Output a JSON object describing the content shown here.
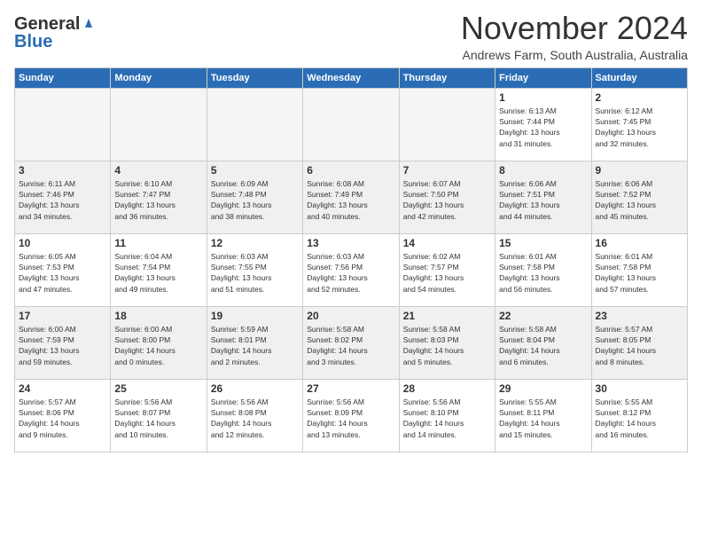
{
  "header": {
    "logo_line1": "General",
    "logo_line2": "Blue",
    "month": "November 2024",
    "location": "Andrews Farm, South Australia, Australia"
  },
  "weekdays": [
    "Sunday",
    "Monday",
    "Tuesday",
    "Wednesday",
    "Thursday",
    "Friday",
    "Saturday"
  ],
  "weeks": [
    [
      {
        "day": "",
        "info": ""
      },
      {
        "day": "",
        "info": ""
      },
      {
        "day": "",
        "info": ""
      },
      {
        "day": "",
        "info": ""
      },
      {
        "day": "",
        "info": ""
      },
      {
        "day": "1",
        "info": "Sunrise: 6:13 AM\nSunset: 7:44 PM\nDaylight: 13 hours\nand 31 minutes."
      },
      {
        "day": "2",
        "info": "Sunrise: 6:12 AM\nSunset: 7:45 PM\nDaylight: 13 hours\nand 32 minutes."
      }
    ],
    [
      {
        "day": "3",
        "info": "Sunrise: 6:11 AM\nSunset: 7:46 PM\nDaylight: 13 hours\nand 34 minutes."
      },
      {
        "day": "4",
        "info": "Sunrise: 6:10 AM\nSunset: 7:47 PM\nDaylight: 13 hours\nand 36 minutes."
      },
      {
        "day": "5",
        "info": "Sunrise: 6:09 AM\nSunset: 7:48 PM\nDaylight: 13 hours\nand 38 minutes."
      },
      {
        "day": "6",
        "info": "Sunrise: 6:08 AM\nSunset: 7:49 PM\nDaylight: 13 hours\nand 40 minutes."
      },
      {
        "day": "7",
        "info": "Sunrise: 6:07 AM\nSunset: 7:50 PM\nDaylight: 13 hours\nand 42 minutes."
      },
      {
        "day": "8",
        "info": "Sunrise: 6:06 AM\nSunset: 7:51 PM\nDaylight: 13 hours\nand 44 minutes."
      },
      {
        "day": "9",
        "info": "Sunrise: 6:06 AM\nSunset: 7:52 PM\nDaylight: 13 hours\nand 45 minutes."
      }
    ],
    [
      {
        "day": "10",
        "info": "Sunrise: 6:05 AM\nSunset: 7:53 PM\nDaylight: 13 hours\nand 47 minutes."
      },
      {
        "day": "11",
        "info": "Sunrise: 6:04 AM\nSunset: 7:54 PM\nDaylight: 13 hours\nand 49 minutes."
      },
      {
        "day": "12",
        "info": "Sunrise: 6:03 AM\nSunset: 7:55 PM\nDaylight: 13 hours\nand 51 minutes."
      },
      {
        "day": "13",
        "info": "Sunrise: 6:03 AM\nSunset: 7:56 PM\nDaylight: 13 hours\nand 52 minutes."
      },
      {
        "day": "14",
        "info": "Sunrise: 6:02 AM\nSunset: 7:57 PM\nDaylight: 13 hours\nand 54 minutes."
      },
      {
        "day": "15",
        "info": "Sunrise: 6:01 AM\nSunset: 7:58 PM\nDaylight: 13 hours\nand 56 minutes."
      },
      {
        "day": "16",
        "info": "Sunrise: 6:01 AM\nSunset: 7:58 PM\nDaylight: 13 hours\nand 57 minutes."
      }
    ],
    [
      {
        "day": "17",
        "info": "Sunrise: 6:00 AM\nSunset: 7:59 PM\nDaylight: 13 hours\nand 59 minutes."
      },
      {
        "day": "18",
        "info": "Sunrise: 6:00 AM\nSunset: 8:00 PM\nDaylight: 14 hours\nand 0 minutes."
      },
      {
        "day": "19",
        "info": "Sunrise: 5:59 AM\nSunset: 8:01 PM\nDaylight: 14 hours\nand 2 minutes."
      },
      {
        "day": "20",
        "info": "Sunrise: 5:58 AM\nSunset: 8:02 PM\nDaylight: 14 hours\nand 3 minutes."
      },
      {
        "day": "21",
        "info": "Sunrise: 5:58 AM\nSunset: 8:03 PM\nDaylight: 14 hours\nand 5 minutes."
      },
      {
        "day": "22",
        "info": "Sunrise: 5:58 AM\nSunset: 8:04 PM\nDaylight: 14 hours\nand 6 minutes."
      },
      {
        "day": "23",
        "info": "Sunrise: 5:57 AM\nSunset: 8:05 PM\nDaylight: 14 hours\nand 8 minutes."
      }
    ],
    [
      {
        "day": "24",
        "info": "Sunrise: 5:57 AM\nSunset: 8:06 PM\nDaylight: 14 hours\nand 9 minutes."
      },
      {
        "day": "25",
        "info": "Sunrise: 5:56 AM\nSunset: 8:07 PM\nDaylight: 14 hours\nand 10 minutes."
      },
      {
        "day": "26",
        "info": "Sunrise: 5:56 AM\nSunset: 8:08 PM\nDaylight: 14 hours\nand 12 minutes."
      },
      {
        "day": "27",
        "info": "Sunrise: 5:56 AM\nSunset: 8:09 PM\nDaylight: 14 hours\nand 13 minutes."
      },
      {
        "day": "28",
        "info": "Sunrise: 5:56 AM\nSunset: 8:10 PM\nDaylight: 14 hours\nand 14 minutes."
      },
      {
        "day": "29",
        "info": "Sunrise: 5:55 AM\nSunset: 8:11 PM\nDaylight: 14 hours\nand 15 minutes."
      },
      {
        "day": "30",
        "info": "Sunrise: 5:55 AM\nSunset: 8:12 PM\nDaylight: 14 hours\nand 16 minutes."
      }
    ]
  ]
}
